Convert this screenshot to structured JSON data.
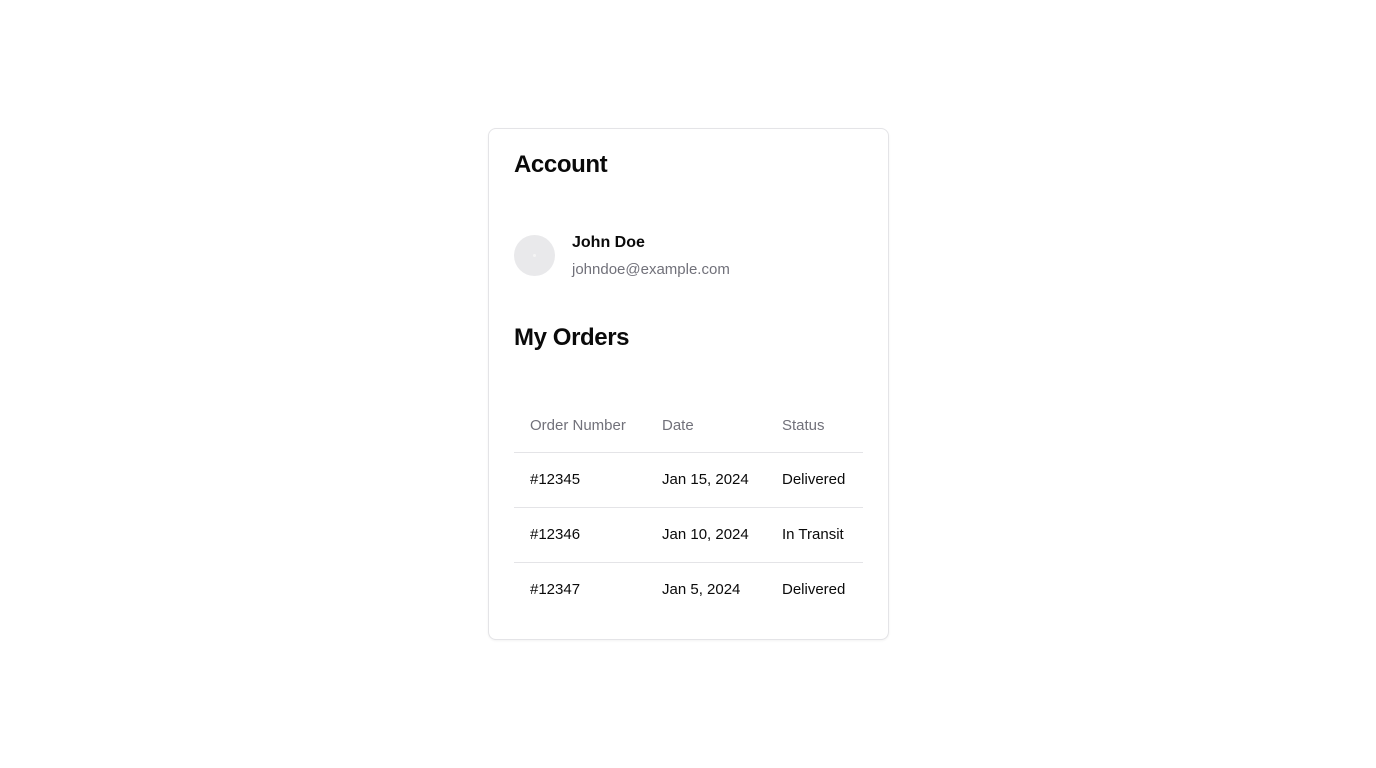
{
  "account": {
    "title": "Account",
    "user": {
      "name": "John Doe",
      "email": "johndoe@example.com"
    }
  },
  "orders": {
    "title": "My Orders",
    "columns": [
      "Order Number",
      "Date",
      "Status"
    ],
    "rows": [
      [
        "#12345",
        "Jan 15, 2024",
        "Delivered"
      ],
      [
        "#12346",
        "Jan 10, 2024",
        "In Transit"
      ],
      [
        "#12347",
        "Jan 5, 2024",
        "Delivered"
      ]
    ]
  },
  "colors": {
    "text": "#0a0a0a",
    "muted": "#71717a",
    "border": "#e4e4e7",
    "avatar_bg": "#e9e9eb"
  }
}
